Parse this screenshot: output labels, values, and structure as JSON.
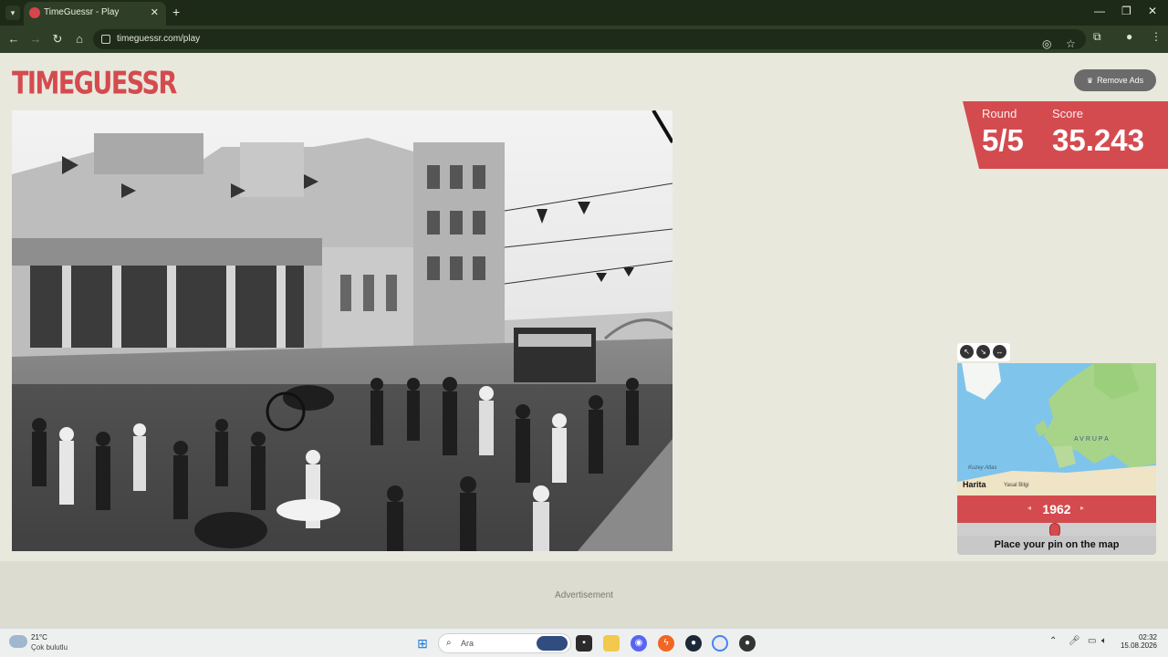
{
  "browser": {
    "tab_title": "TimeGuessr - Play",
    "new_tab": "+",
    "url": "timeguessr.com/play",
    "controls": {
      "minimize": "—",
      "restore": "❐",
      "close": "✕"
    }
  },
  "page": {
    "logo": "TIMEGUESSR",
    "remove_ads": "Remove Ads",
    "round_label": "Round",
    "round_value": "5/5",
    "score_label": "Score",
    "score_value": "35.243",
    "map": {
      "europe_label": "AVRUPA",
      "north_atlantic": "Kuzey Atlas",
      "attribution": "Harita",
      "legal": "Yasal Bilgi"
    },
    "year": "1962",
    "year_prev": "◂",
    "year_next": "▸",
    "place_pin": "Place your pin on the map",
    "advertisement": "Advertisement",
    "accent_color": "#d44b4f"
  },
  "taskbar": {
    "temperature": "21°C",
    "condition": "Çok bulutlu",
    "search_placeholder": "Ara",
    "time": "02:32",
    "date": "15.08.2026"
  }
}
